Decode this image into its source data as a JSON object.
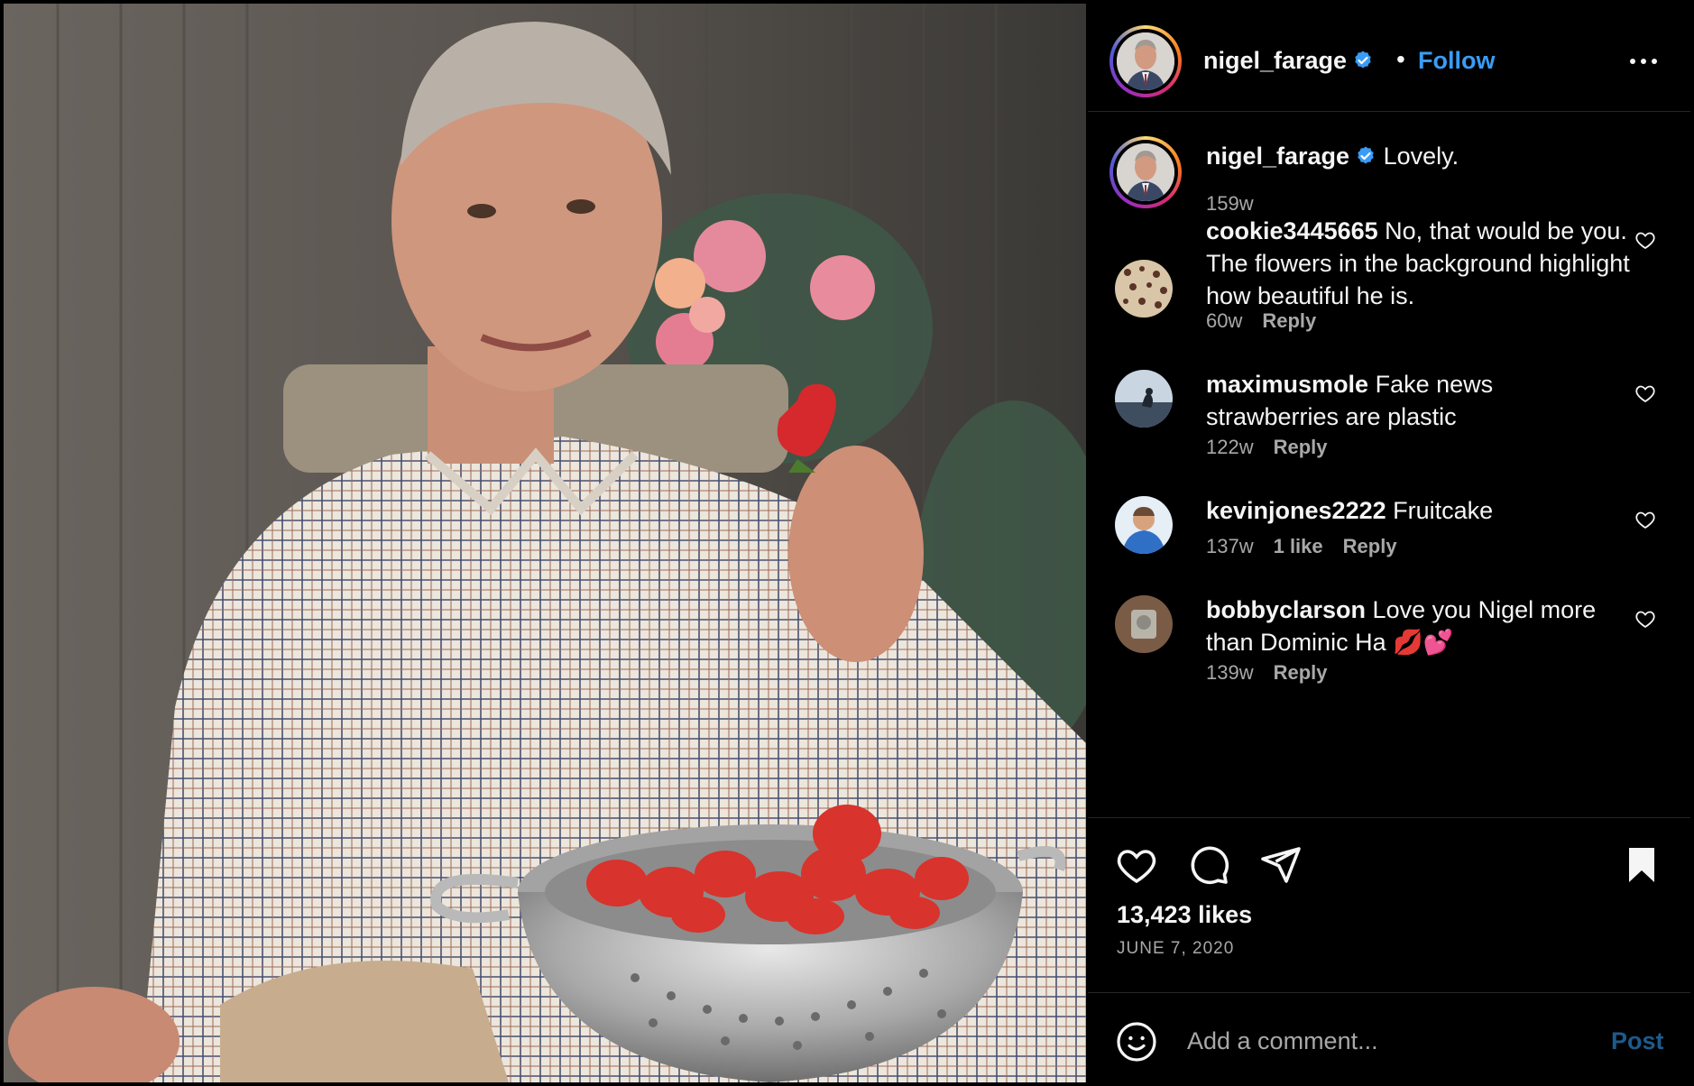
{
  "post": {
    "author": "nigel_farage",
    "follow_label": "Follow",
    "separator": "•",
    "more_icon": "more-horizontal-icon",
    "caption": {
      "username": "nigel_farage",
      "text": "Lovely.",
      "time": "159w"
    },
    "comments": [
      {
        "username": "cookie3445665",
        "text": "No, that would be you. The flowers in the background highlight how beautiful he is.",
        "time": "60w",
        "likes": "",
        "reply_label": "Reply"
      },
      {
        "username": "maximusmole",
        "text": "Fake news strawberries are plastic",
        "time": "122w",
        "likes": "",
        "reply_label": "Reply"
      },
      {
        "username": "kevinjones2222",
        "text": "Fruitcake",
        "time": "137w",
        "likes": "1 like",
        "reply_label": "Reply"
      },
      {
        "username": "bobbyclarson",
        "text": "Love you Nigel more than Dominic Ha 💋💕",
        "time": "139w",
        "likes": "",
        "reply_label": "Reply"
      }
    ],
    "likes_label": "13,423 likes",
    "date": "JUNE 7, 2020",
    "add_comment_placeholder": "Add a comment...",
    "post_label": "Post"
  },
  "colors": {
    "background": "#000000",
    "accent_blue": "#3a9cf6",
    "muted_text": "#a8a8a8",
    "post_button_disabled": "#1e5a8c",
    "divider": "#262626"
  }
}
